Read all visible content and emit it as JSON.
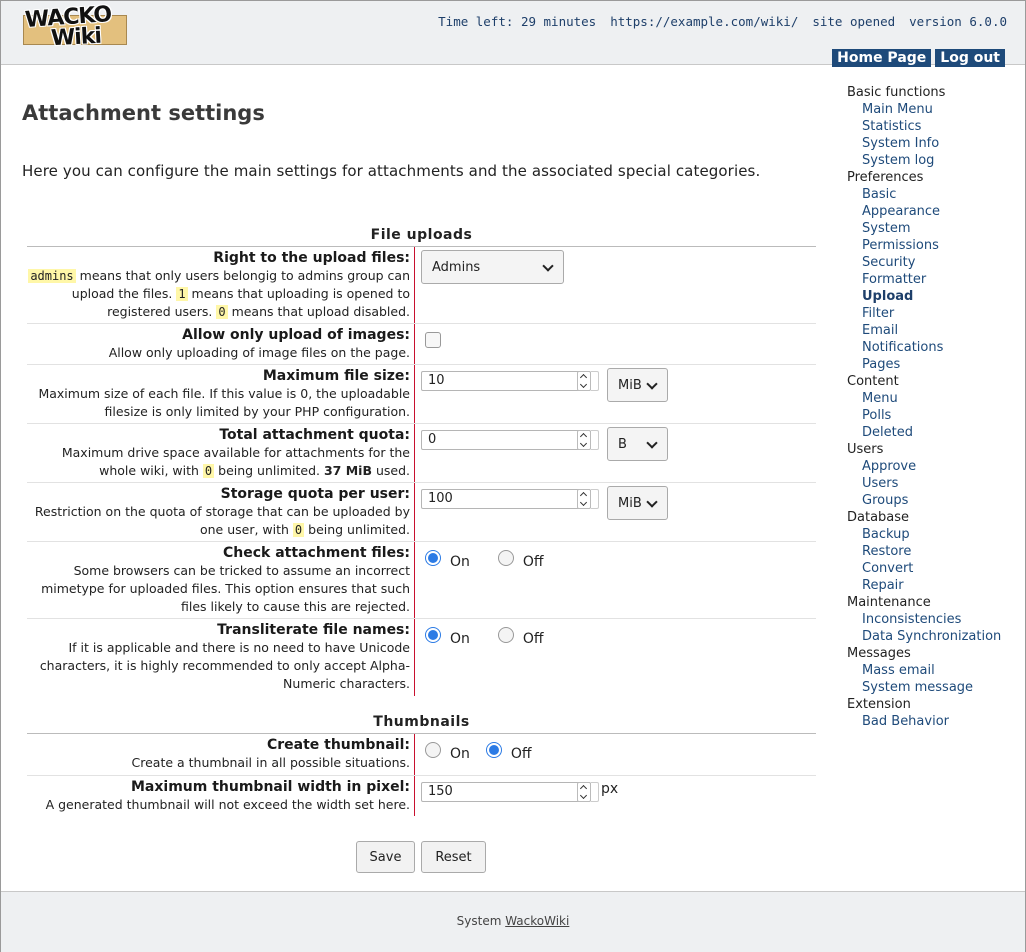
{
  "header": {
    "logo_top": "WACKO",
    "logo_bottom": "Wiki",
    "time_left": "Time left: 29 minutes",
    "url": "https://example.com/wiki/",
    "site_status": "site opened",
    "version": "version 6.0.0",
    "nav": {
      "home": "Home Page",
      "logout": "Log out"
    }
  },
  "page": {
    "title": "Attachment settings",
    "intro": "Here you can configure the main settings for attachments and the associated special categories."
  },
  "sections": {
    "uploads": "File uploads",
    "thumbs": "Thumbnails"
  },
  "fields": {
    "upload_right": {
      "label": "Right to the upload files:",
      "code1": "admins",
      "desc1": " means that only users belongig to admins group can upload the files. ",
      "code2": "1",
      "desc2": " means that uploading is opened to registered users. ",
      "code3": "0",
      "desc3": " means that upload disabled.",
      "value": "Admins"
    },
    "images_only": {
      "label": "Allow only upload of images:",
      "desc": "Allow only uploading of image files on the page."
    },
    "max_size": {
      "label": "Maximum file size:",
      "desc": "Maximum size of each file. If this value is 0, the uploadable filesize is only limited by your PHP configuration.",
      "value": "10",
      "unit": "MiB"
    },
    "quota": {
      "label": "Total attachment quota:",
      "desc1": "Maximum drive space available for attachments for the whole wiki, with ",
      "code": "0",
      "desc2": " being unlimited. ",
      "used": "37 MiB",
      "desc3": " used.",
      "value": "0",
      "unit": "B"
    },
    "user_quota": {
      "label": "Storage quota per user:",
      "desc1": "Restriction on the quota of storage that can be uploaded by one user, with ",
      "code": "0",
      "desc2": " being unlimited.",
      "value": "100",
      "unit": "MiB"
    },
    "check_files": {
      "label": "Check attachment files:",
      "desc": "Some browsers can be tricked to assume an incorrect mimetype for uploaded files. This option ensures that such files likely to cause this are rejected.",
      "on": "On",
      "off": "Off"
    },
    "translit": {
      "label": "Transliterate file names:",
      "desc": "If it is applicable and there is no need to have Unicode characters, it is highly recommended to only accept Alpha-Numeric characters.",
      "on": "On",
      "off": "Off"
    },
    "create_thumb": {
      "label": "Create thumbnail:",
      "desc": "Create a thumbnail in all possible situations.",
      "on": "On",
      "off": "Off"
    },
    "thumb_width": {
      "label": "Maximum thumbnail width in pixel:",
      "desc": "A generated thumbnail will not exceed the width set here.",
      "value": "150",
      "unit": "px"
    }
  },
  "buttons": {
    "save": "Save",
    "reset": "Reset"
  },
  "sidebar": {
    "basic": "Basic functions",
    "main_menu": "Main Menu",
    "statistics": "Statistics",
    "system_info": "System Info",
    "system_log": "System log",
    "preferences": "Preferences",
    "basic_item": "Basic",
    "appearance": "Appearance",
    "system": "System",
    "permissions": "Permissions",
    "security": "Security",
    "formatter": "Formatter",
    "upload": "Upload",
    "filter": "Filter",
    "email": "Email",
    "notifications": "Notifications",
    "pages": "Pages",
    "content": "Content",
    "menu": "Menu",
    "polls": "Polls",
    "deleted": "Deleted",
    "users": "Users",
    "approve": "Approve",
    "users_item": "Users",
    "groups": "Groups",
    "database": "Database",
    "backup": "Backup",
    "restore": "Restore",
    "convert": "Convert",
    "repair": "Repair",
    "maintenance": "Maintenance",
    "inconsistencies": "Inconsistencies",
    "data_sync": "Data Synchronization",
    "messages": "Messages",
    "mass_email": "Mass email",
    "system_message": "System message",
    "extension": "Extension",
    "bad_behavior": "Bad Behavior"
  },
  "footer": {
    "prefix": "System ",
    "link": "WackoWiki"
  }
}
